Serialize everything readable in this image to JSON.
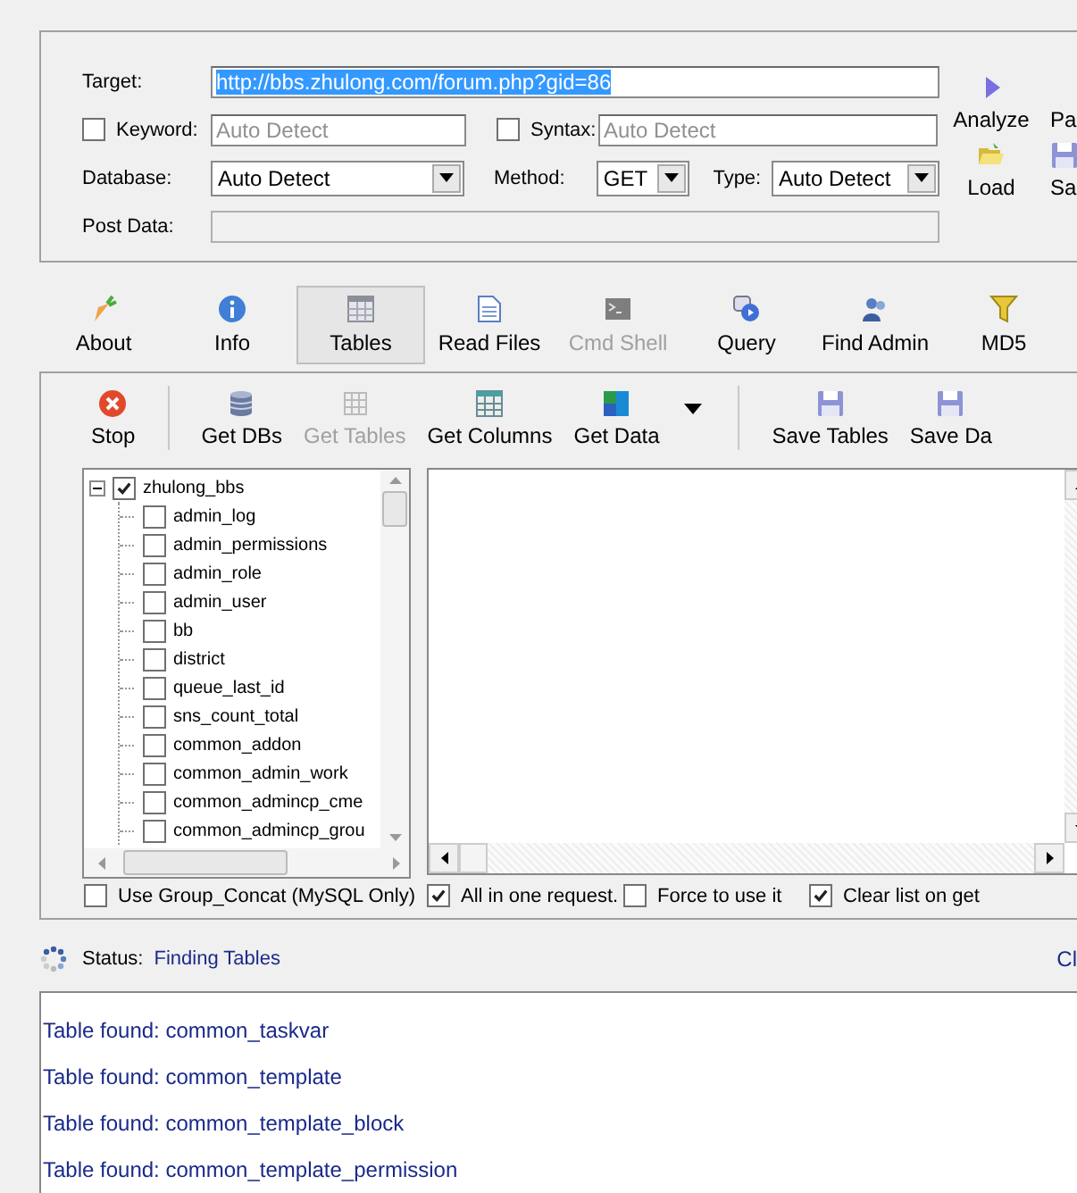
{
  "target": {
    "label": "Target:",
    "value": "http://bbs.zhulong.com/forum.php?gid=86",
    "highlighted": true
  },
  "keyword": {
    "label": "Keyword:",
    "checked": false,
    "placeholder": "Auto Detect"
  },
  "syntax": {
    "label": "Syntax:",
    "checked": false,
    "placeholder": "Auto Detect"
  },
  "database": {
    "label": "Database:",
    "value": "Auto Detect"
  },
  "method": {
    "label": "Method:",
    "value": "GET"
  },
  "type": {
    "label": "Type:",
    "value": "Auto Detect"
  },
  "post_data": {
    "label": "Post Data:",
    "disabled": true
  },
  "side_actions": [
    {
      "kind": "play",
      "label": "Analyze"
    },
    {
      "kind": "none",
      "label": "Pa"
    },
    {
      "kind": "folder",
      "label": "Load"
    },
    {
      "kind": "disk",
      "label": "Sa"
    }
  ],
  "tabs": [
    {
      "label": "About",
      "selected": false,
      "disabled": false
    },
    {
      "label": "Info",
      "selected": false,
      "disabled": false
    },
    {
      "label": "Tables",
      "selected": true,
      "disabled": false
    },
    {
      "label": "Read Files",
      "selected": false,
      "disabled": false
    },
    {
      "label": "Cmd Shell",
      "selected": false,
      "disabled": true
    },
    {
      "label": "Query",
      "selected": false,
      "disabled": false
    },
    {
      "label": "Find Admin",
      "selected": false,
      "disabled": false
    },
    {
      "label": "MD5",
      "selected": false,
      "disabled": false
    }
  ],
  "toolbar": [
    {
      "kind": "stop",
      "label": "Stop",
      "disabled": false
    },
    {
      "kind": "separator"
    },
    {
      "kind": "database",
      "label": "Get DBs",
      "disabled": false
    },
    {
      "kind": "grid",
      "label": "Get Tables",
      "disabled": true
    },
    {
      "kind": "columns",
      "label": "Get Columns",
      "disabled": false
    },
    {
      "kind": "data",
      "label": "Get Data",
      "disabled": false
    },
    {
      "kind": "dropdown"
    },
    {
      "kind": "separator"
    },
    {
      "kind": "disk",
      "label": "Save Tables",
      "disabled": false
    },
    {
      "kind": "disk",
      "label": "Save Da",
      "disabled": false
    }
  ],
  "tree": {
    "label": "zhulong_bbs",
    "checked": true,
    "expanded": true,
    "children": [
      {
        "label": "admin_log",
        "checked": false
      },
      {
        "label": "admin_permissions",
        "checked": false
      },
      {
        "label": "admin_role",
        "checked": false
      },
      {
        "label": "admin_user",
        "checked": false
      },
      {
        "label": "bb",
        "checked": false
      },
      {
        "label": "district",
        "checked": false
      },
      {
        "label": "queue_last_id",
        "checked": false
      },
      {
        "label": "sns_count_total",
        "checked": false
      },
      {
        "label": "common_addon",
        "checked": false
      },
      {
        "label": "common_admin_work",
        "checked": false
      },
      {
        "label": "common_admincp_cme",
        "checked": false
      },
      {
        "label": "common_admincp_grou",
        "checked": false
      }
    ]
  },
  "options": [
    {
      "label": "Use Group_Concat (MySQL Only)",
      "checked": false
    },
    {
      "label": "All in one request.",
      "checked": true
    },
    {
      "label": "Force to use it",
      "checked": false
    },
    {
      "label": "Clear list on get",
      "checked": true
    }
  ],
  "status": {
    "label": "Status:",
    "value": "Finding Tables",
    "right_text": "Cl"
  },
  "log": [
    "Table found: common_taskvar",
    "Table found: common_template",
    "Table found: common_template_block",
    "Table found: common_template_permission"
  ]
}
